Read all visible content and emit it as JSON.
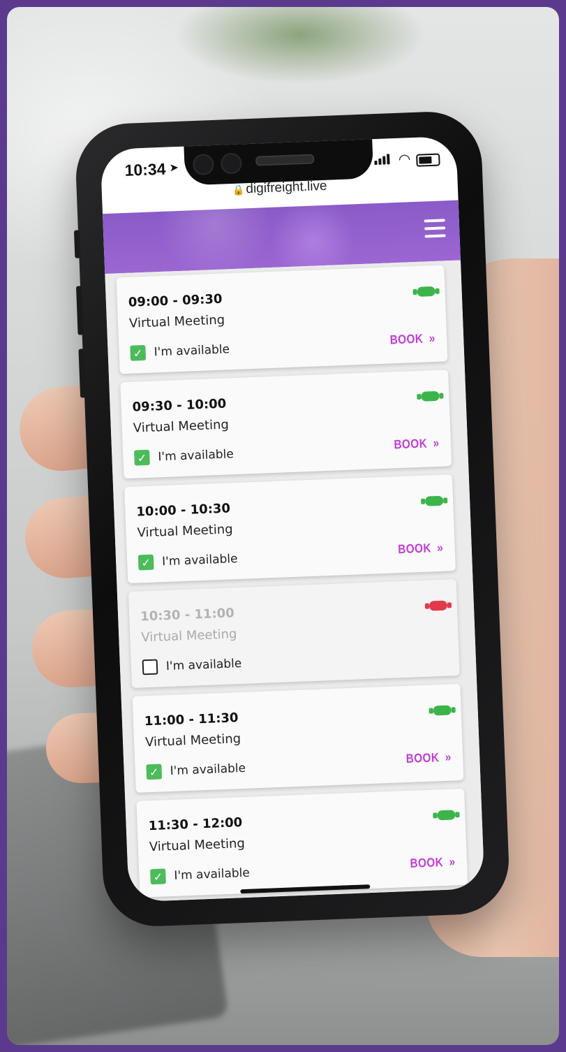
{
  "status_bar": {
    "time": "10:34"
  },
  "browser": {
    "url": "digifreight.live"
  },
  "slots": [
    {
      "time": "09:00 - 09:30",
      "type": "Virtual Meeting",
      "available_label": "I'm available",
      "checked": true,
      "book_label": "BOOK",
      "book_chevron": "»",
      "status_color": "#3bb54a"
    },
    {
      "time": "09:30 - 10:00",
      "type": "Virtual Meeting",
      "available_label": "I'm available",
      "checked": true,
      "book_label": "BOOK",
      "book_chevron": "»",
      "status_color": "#3bb54a"
    },
    {
      "time": "10:00 - 10:30",
      "type": "Virtual Meeting",
      "available_label": "I'm available",
      "checked": true,
      "book_label": "BOOK",
      "book_chevron": "»",
      "status_color": "#3bb54a"
    },
    {
      "time": "10:30 - 11:00",
      "type": "Virtual Meeting",
      "available_label": "I'm available",
      "checked": false,
      "status_color": "#e23a4b"
    },
    {
      "time": "11:00 - 11:30",
      "type": "Virtual Meeting",
      "available_label": "I'm available",
      "checked": true,
      "book_label": "BOOK",
      "book_chevron": "»",
      "status_color": "#3bb54a"
    },
    {
      "time": "11:30 - 12:00",
      "type": "Virtual Meeting",
      "available_label": "I'm available",
      "checked": true,
      "book_label": "BOOK",
      "book_chevron": "»",
      "status_color": "#3bb54a"
    }
  ],
  "theme": {
    "header_color": "#8a5bc8",
    "book_color": "#c23dd8",
    "frame_color": "#5b3a8e"
  }
}
